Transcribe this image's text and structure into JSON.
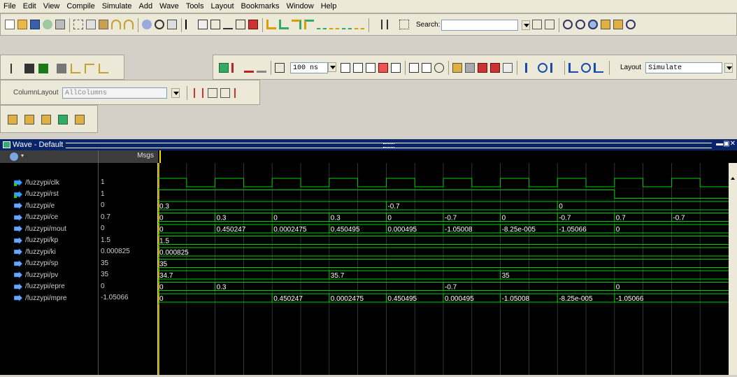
{
  "menu": [
    "File",
    "Edit",
    "View",
    "Compile",
    "Simulate",
    "Add",
    "Wave",
    "Tools",
    "Layout",
    "Bookmarks",
    "Window",
    "Help"
  ],
  "toolbar": {
    "search_label": "Search:",
    "search_value": "",
    "runtime_value": "100 ns",
    "layout_label": "Layout",
    "layout_value": "Simulate",
    "column_layout_label": "ColumnLayout",
    "column_layout_value": "AllColumns"
  },
  "wave_window": {
    "title": "Wave - Default",
    "msgs_header": "Msgs",
    "signals": [
      {
        "name": "/fuzzypi/clk",
        "value": "1",
        "kind": "in"
      },
      {
        "name": "/fuzzypi/rst",
        "value": "1",
        "kind": "in"
      },
      {
        "name": "/fuzzypi/e",
        "value": "0",
        "kind": "out"
      },
      {
        "name": "/fuzzypi/ce",
        "value": "0.7",
        "kind": "out"
      },
      {
        "name": "/fuzzypi/mout",
        "value": "0",
        "kind": "out"
      },
      {
        "name": "/fuzzypi/kp",
        "value": "1.5",
        "kind": "out"
      },
      {
        "name": "/fuzzypi/ki",
        "value": "0.000825",
        "kind": "out"
      },
      {
        "name": "/fuzzypi/sp",
        "value": "35",
        "kind": "out"
      },
      {
        "name": "/fuzzypi/pv",
        "value": "35",
        "kind": "out"
      },
      {
        "name": "/fuzzypi/epre",
        "value": "0",
        "kind": "out"
      },
      {
        "name": "/fuzzypi/mpre",
        "value": "-1.05066",
        "kind": "out"
      }
    ],
    "bus_values": {
      "e": [
        {
          "start": 0,
          "text": "0.3"
        },
        {
          "start": 8,
          "text": "-0.7"
        },
        {
          "start": 14,
          "text": "0"
        }
      ],
      "ce": [
        {
          "start": 0,
          "text": "0"
        },
        {
          "start": 2,
          "text": "0.3"
        },
        {
          "start": 4,
          "text": "0"
        },
        {
          "start": 6,
          "text": "0.3"
        },
        {
          "start": 8,
          "text": "0"
        },
        {
          "start": 10,
          "text": "-0.7"
        },
        {
          "start": 12,
          "text": "0"
        },
        {
          "start": 14,
          "text": "-0.7"
        },
        {
          "start": 16,
          "text": "0.7"
        },
        {
          "start": 18,
          "text": "-0.7"
        }
      ],
      "mout": [
        {
          "start": 0,
          "text": "0"
        },
        {
          "start": 2,
          "text": "0.450247"
        },
        {
          "start": 4,
          "text": "0.0002475"
        },
        {
          "start": 6,
          "text": "0.450495"
        },
        {
          "start": 8,
          "text": "0.000495"
        },
        {
          "start": 10,
          "text": "-1.05008"
        },
        {
          "start": 12,
          "text": "-8.25e-005"
        },
        {
          "start": 14,
          "text": "-1.05066"
        },
        {
          "start": 16,
          "text": "0"
        }
      ],
      "kp": [
        {
          "start": 0,
          "text": "1.5"
        }
      ],
      "ki": [
        {
          "start": 0,
          "text": "0.000825"
        }
      ],
      "sp": [
        {
          "start": 0,
          "text": "35"
        }
      ],
      "pv": [
        {
          "start": 0,
          "text": "34.7"
        },
        {
          "start": 6,
          "text": "35.7"
        },
        {
          "start": 12,
          "text": "35"
        }
      ],
      "epre": [
        {
          "start": 0,
          "text": "0"
        },
        {
          "start": 2,
          "text": "0.3"
        },
        {
          "start": 10,
          "text": "-0.7"
        },
        {
          "start": 16,
          "text": "0"
        }
      ],
      "mpre": [
        {
          "start": 0,
          "text": "0"
        },
        {
          "start": 4,
          "text": "0.450247"
        },
        {
          "start": 6,
          "text": "0.0002475"
        },
        {
          "start": 8,
          "text": "0.450495"
        },
        {
          "start": 10,
          "text": "0.000495"
        },
        {
          "start": 12,
          "text": "-1.05008"
        },
        {
          "start": 14,
          "text": "-8.25e-005"
        },
        {
          "start": 16,
          "text": "-1.05066"
        }
      ]
    },
    "clk_levels": [
      1,
      0,
      1,
      0,
      1,
      0,
      1,
      0,
      1,
      0,
      1,
      0,
      1,
      0,
      1,
      0,
      1,
      0,
      1,
      0
    ],
    "rst_low_from_slot": 16,
    "total_slots": 20,
    "colors": {
      "wave": "#00d000",
      "name": "#cfcfcf",
      "grid": "#4a4a4a",
      "bg": "#000000",
      "cursor": "#ffd700"
    }
  }
}
